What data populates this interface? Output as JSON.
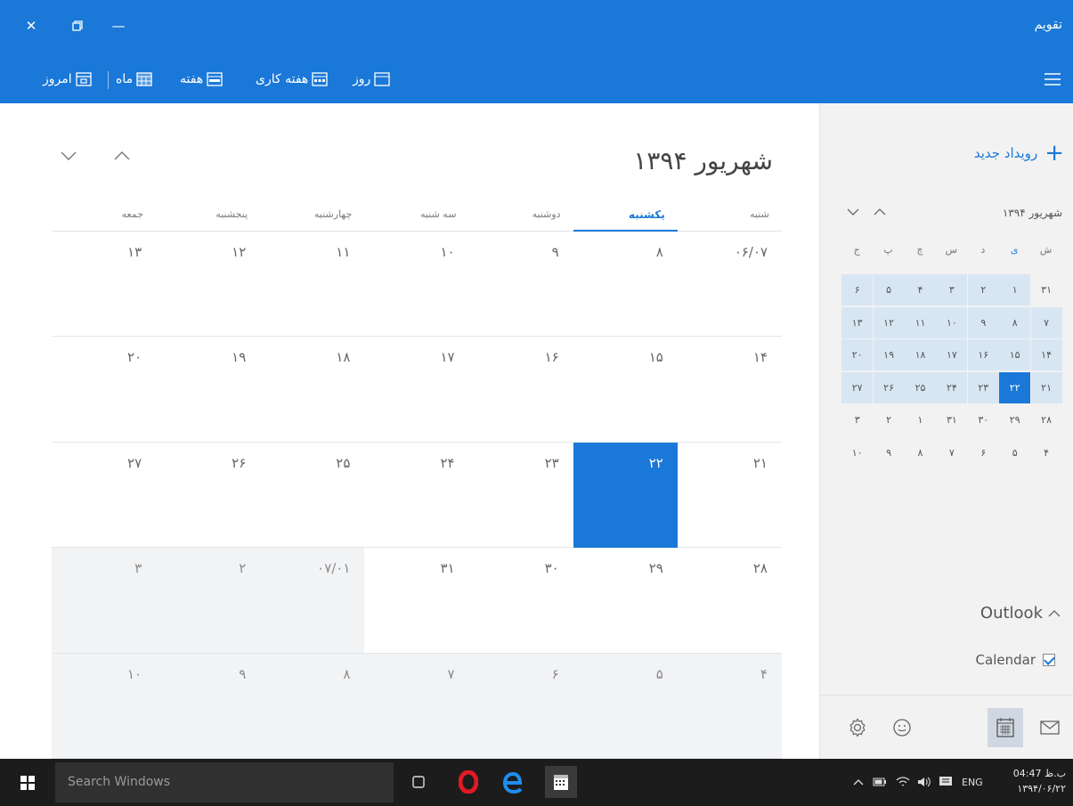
{
  "colors": {
    "accent": "#1a78d8",
    "today_text": "#ffffff"
  },
  "window": {
    "title": "تقویم",
    "close_icon": "close-icon",
    "restore_icon": "restore-icon",
    "minimize_icon": "minimize-icon"
  },
  "toolbar": {
    "today_label": "امروز",
    "month_label": "ماه",
    "week_label": "هفته",
    "workweek_label": "هفته کاری",
    "day_label": "روز"
  },
  "main": {
    "month_title": "شهریور ۱۳۹۴",
    "weekdays": [
      "شنبه",
      "یکشنبه",
      "دوشنبه",
      "سه شنبه",
      "چهارشنبه",
      "پنجشنبه",
      "جمعه"
    ],
    "active_weekday_index": 1,
    "weeks": [
      [
        {
          "d": "۰۶/۰۷",
          "o": false
        },
        {
          "d": "۸",
          "o": false
        },
        {
          "d": "۹",
          "o": false
        },
        {
          "d": "۱۰",
          "o": false
        },
        {
          "d": "۱۱",
          "o": false
        },
        {
          "d": "۱۲",
          "o": false
        },
        {
          "d": "۱۳",
          "o": false
        }
      ],
      [
        {
          "d": "۱۴",
          "o": false
        },
        {
          "d": "۱۵",
          "o": false
        },
        {
          "d": "۱۶",
          "o": false
        },
        {
          "d": "۱۷",
          "o": false
        },
        {
          "d": "۱۸",
          "o": false
        },
        {
          "d": "۱۹",
          "o": false
        },
        {
          "d": "۲۰",
          "o": false
        }
      ],
      [
        {
          "d": "۲۱",
          "o": false
        },
        {
          "d": "۲۲",
          "o": false,
          "today": true
        },
        {
          "d": "۲۳",
          "o": false
        },
        {
          "d": "۲۴",
          "o": false
        },
        {
          "d": "۲۵",
          "o": false
        },
        {
          "d": "۲۶",
          "o": false
        },
        {
          "d": "۲۷",
          "o": false
        }
      ],
      [
        {
          "d": "۲۸",
          "o": false
        },
        {
          "d": "۲۹",
          "o": false
        },
        {
          "d": "۳۰",
          "o": false
        },
        {
          "d": "۳۱",
          "o": false
        },
        {
          "d": "۰۷/۰۱",
          "o": true
        },
        {
          "d": "۲",
          "o": true
        },
        {
          "d": "۳",
          "o": true
        }
      ],
      [
        {
          "d": "۴",
          "o": true
        },
        {
          "d": "۵",
          "o": true
        },
        {
          "d": "۶",
          "o": true
        },
        {
          "d": "۷",
          "o": true
        },
        {
          "d": "۸",
          "o": true
        },
        {
          "d": "۹",
          "o": true
        },
        {
          "d": "۱۰",
          "o": true
        }
      ]
    ]
  },
  "sidebar": {
    "new_event_label": "رویداد جدید",
    "mini_title": "شهریور ۱۳۹۴",
    "mini_headers": [
      "ش",
      "ی",
      "د",
      "س",
      "چ",
      "پ",
      "ج"
    ],
    "mini_active_header_index": 1,
    "mini_weeks": [
      [
        {
          "d": "۳۱",
          "m": false
        },
        {
          "d": "۱",
          "m": true
        },
        {
          "d": "۲",
          "m": true
        },
        {
          "d": "۳",
          "m": true
        },
        {
          "d": "۴",
          "m": true
        },
        {
          "d": "۵",
          "m": true
        },
        {
          "d": "۶",
          "m": true
        }
      ],
      [
        {
          "d": "۷",
          "m": true
        },
        {
          "d": "۸",
          "m": true
        },
        {
          "d": "۹",
          "m": true
        },
        {
          "d": "۱۰",
          "m": true
        },
        {
          "d": "۱۱",
          "m": true
        },
        {
          "d": "۱۲",
          "m": true
        },
        {
          "d": "۱۳",
          "m": true
        }
      ],
      [
        {
          "d": "۱۴",
          "m": true
        },
        {
          "d": "۱۵",
          "m": true
        },
        {
          "d": "۱۶",
          "m": true
        },
        {
          "d": "۱۷",
          "m": true
        },
        {
          "d": "۱۸",
          "m": true
        },
        {
          "d": "۱۹",
          "m": true
        },
        {
          "d": "۲۰",
          "m": true
        }
      ],
      [
        {
          "d": "۲۱",
          "m": true
        },
        {
          "d": "۲۲",
          "m": true,
          "today": true
        },
        {
          "d": "۲۳",
          "m": true
        },
        {
          "d": "۲۴",
          "m": true
        },
        {
          "d": "۲۵",
          "m": true
        },
        {
          "d": "۲۶",
          "m": true
        },
        {
          "d": "۲۷",
          "m": true
        }
      ],
      [
        {
          "d": "۲۸",
          "m": false
        },
        {
          "d": "۲۹",
          "m": false
        },
        {
          "d": "۳۰",
          "m": false
        },
        {
          "d": "۳۱",
          "m": false
        },
        {
          "d": "۱",
          "m": false
        },
        {
          "d": "۲",
          "m": false
        },
        {
          "d": "۳",
          "m": false
        }
      ],
      [
        {
          "d": "۴",
          "m": false
        },
        {
          "d": "۵",
          "m": false
        },
        {
          "d": "۶",
          "m": false
        },
        {
          "d": "۷",
          "m": false
        },
        {
          "d": "۸",
          "m": false
        },
        {
          "d": "۹",
          "m": false
        },
        {
          "d": "۱۰",
          "m": false
        }
      ]
    ],
    "outlook_label": "Outlook",
    "calendar_label": "Calendar",
    "calendar_checked": true
  },
  "taskbar": {
    "search_placeholder": "Search Windows",
    "language": "ENG",
    "time": "04:47 ب.ظ",
    "date": "۱۳۹۴/۰۶/۲۲"
  }
}
